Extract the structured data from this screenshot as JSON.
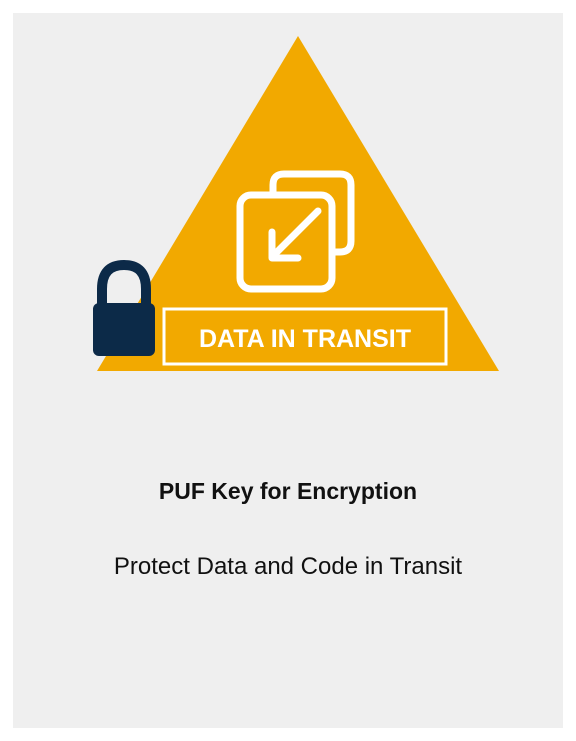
{
  "badge": {
    "label": "DATA IN TRANSIT",
    "icons": [
      "padlock-icon",
      "transfer-arrows-icon"
    ],
    "colors": {
      "triangle": "#f2a900",
      "padlock": "#0c2a48",
      "icon_stroke": "#ffffff",
      "label_box": "#f2a900"
    }
  },
  "card": {
    "title": "PUF Key for Encryption",
    "subtitle": "Protect Data and Code in Transit",
    "background": "#efefef"
  }
}
